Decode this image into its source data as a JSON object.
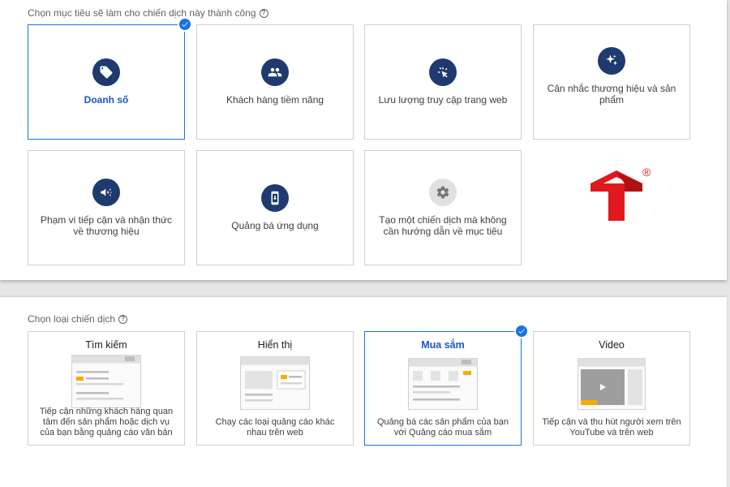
{
  "goals_section": {
    "title": "Chọn mục tiêu sẽ làm cho chiến dịch này thành công",
    "help": "?",
    "cards": [
      {
        "label": "Doanh số",
        "icon": "tag-icon",
        "selected": true
      },
      {
        "label": "Khách hàng tiềm năng",
        "icon": "people-icon",
        "selected": false
      },
      {
        "label": "Lưu lượng truy cập trang web",
        "icon": "cursor-click-icon",
        "selected": false
      },
      {
        "label": "Cân nhắc thương hiệu và sản phẩm",
        "icon": "sparkle-icon",
        "selected": false
      },
      {
        "label": "Phạm vi tiếp cận và nhận thức về thương hiệu",
        "icon": "megaphone-icon",
        "selected": false
      },
      {
        "label": "Quảng bá ứng dụng",
        "icon": "phone-download-icon",
        "selected": false
      },
      {
        "label": "Tạo một chiến dịch mà không cần hướng dẫn về mục tiêu",
        "icon": "gear-icon",
        "selected": false
      }
    ]
  },
  "types_section": {
    "title": "Chọn loại chiến dịch",
    "help": "?",
    "cards": [
      {
        "title": "Tìm kiếm",
        "description": "Tiếp cận những khách hàng quan tâm đến sản phẩm hoặc dịch vụ của bạn bằng quảng cáo văn bản",
        "selected": false
      },
      {
        "title": "Hiển thị",
        "description": "Chạy các loại quảng cáo khác nhau trên web",
        "selected": false
      },
      {
        "title": "Mua sắm",
        "description": "Quảng bá các sản phẩm của bạn với Quảng cáo mua sắm",
        "selected": true
      },
      {
        "title": "Video",
        "description": "Tiếp cận và thu hút người xem trên YouTube và trên web",
        "selected": false
      }
    ]
  },
  "logo": {
    "registered_mark": "®"
  },
  "colors": {
    "accent": "#1a73e8",
    "icon_bg": "#1e3a6e",
    "logo_red": "#e0191f",
    "highlight": "#f9ab00"
  }
}
